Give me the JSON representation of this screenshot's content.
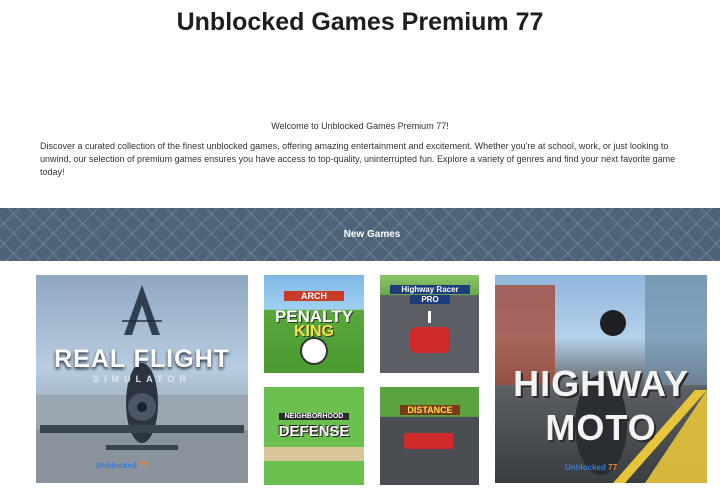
{
  "page": {
    "title": "Unblocked Games Premium 77",
    "welcome": "Welcome to Unblocked Games Premium 77!",
    "description": "Discover a curated collection of the finest unblocked games, offering amazing entertainment and excitement. Whether you're at school, work, or just looking to unwind, our selection of premium games ensures you have access to top-quality, uninterrupted fun. Explore a variety of genres and find your next favorite game today!"
  },
  "new_games": {
    "heading": "New Games",
    "games": [
      {
        "title_line1": "REAL FLIGHT",
        "title_line2": "SIMULATOR",
        "badge_text": "Unblocked",
        "badge_num": "77"
      },
      {
        "title_line1": "PENALTY",
        "title_line2": "KING",
        "top_text": "ARCH"
      },
      {
        "title_line1": "Highway Racer",
        "title_line2": "PRO"
      },
      {
        "title_line1": "NEIGHBORHOOD",
        "title_line2": "DEFENSE"
      },
      {
        "title_line1": "DISTANCE",
        "title_line2": ""
      },
      {
        "title_line1": "HIGHWAY",
        "title_line2": "MOTO",
        "badge_text": "Unblocked",
        "badge_num": "77"
      }
    ]
  },
  "colors": {
    "band": "#4c6378",
    "accent_blue": "#3a7bd5",
    "accent_orange": "#f08030"
  }
}
